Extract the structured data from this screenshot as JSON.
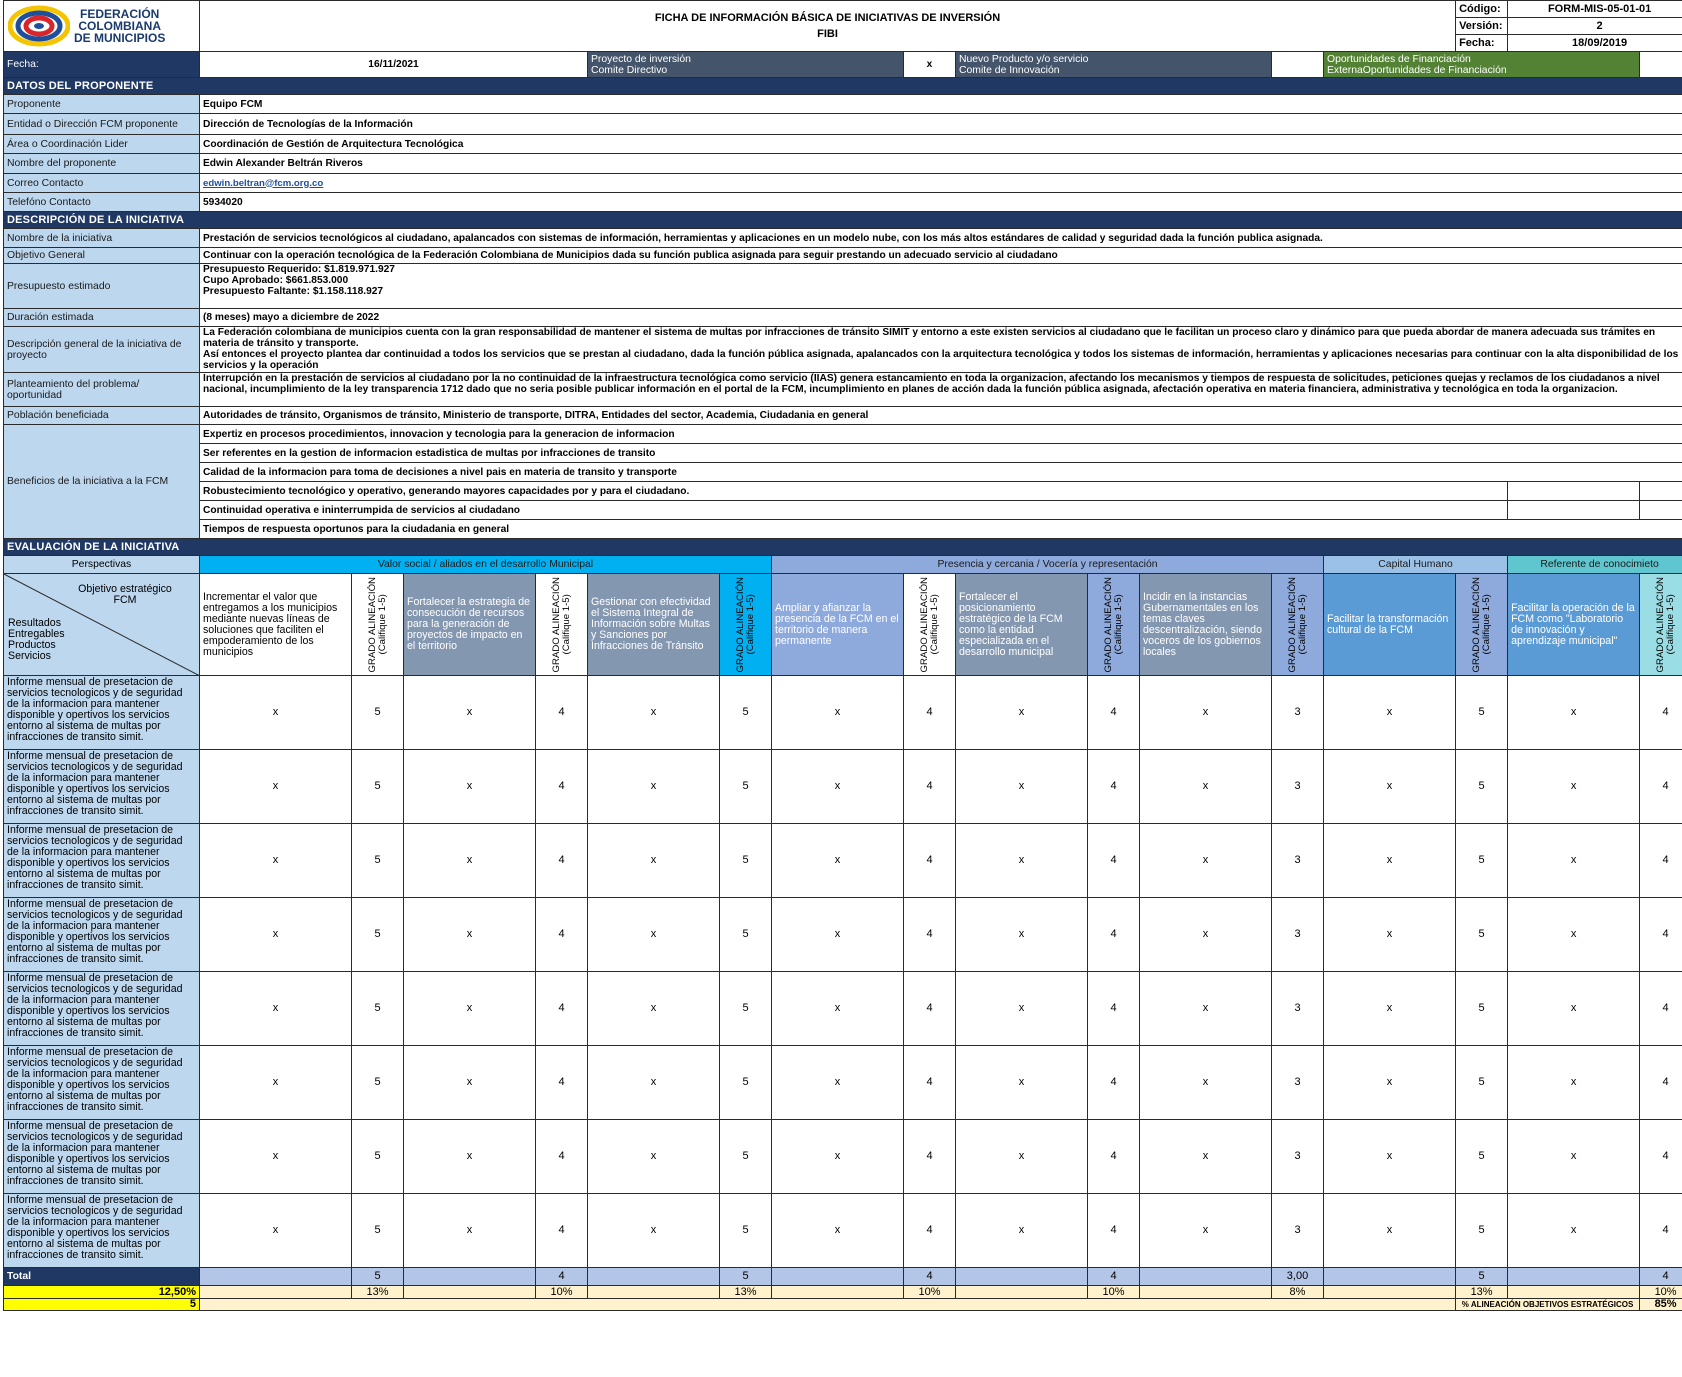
{
  "header": {
    "org_line1": "FEDERACIÓN",
    "org_line2": "COLOMBIANA",
    "org_line3": "DE MUNICIPIOS",
    "title_line1": "FICHA DE INFORMACIÓN BÁSICA DE INICIATIVAS DE INVERSIÓN",
    "title_line2": "FIBI",
    "codigo_label": "Código:",
    "codigo_value": "FORM-MIS-05-01-01",
    "version_label": "Versión:",
    "version_value": "2",
    "fecha_label": "Fecha:",
    "fecha_value": "18/09/2019"
  },
  "fecha_row": {
    "label": "Fecha:",
    "value": "16/11/2021",
    "proyecto_line1": "Proyecto de inversión",
    "proyecto_line2": "Comite Directivo",
    "proyecto_mark": "x",
    "nuevo_line1": "Nuevo Producto y/o servicio",
    "nuevo_line2": "Comite de Innovación",
    "oport_line1": "Oportunidades de Financiación",
    "oport_line2": "ExternaOportunidades de Financiación"
  },
  "proponente": {
    "section": "DATOS DEL PROPONENTE",
    "rows": [
      {
        "label": "Proponente",
        "value": "Equipo FCM"
      },
      {
        "label": "Entidad o Dirección FCM proponente",
        "value": "Dirección de Tecnologías de la Información"
      },
      {
        "label": "Área o Coordinación Lider",
        "value": "Coordinación de Gestión de Arquitectura Tecnológica"
      },
      {
        "label": "Nombre del proponente",
        "value": "Edwin Alexander Beltrán Riveros"
      },
      {
        "label": "Correo Contacto",
        "value": "edwin.beltran@fcm.org.co"
      },
      {
        "label": "Telefóno Contacto",
        "value": "5934020"
      }
    ]
  },
  "descripcion": {
    "section": "DESCRIPCIÓN DE LA INICIATIVA",
    "nombre_label": "Nombre de la iniciativa",
    "nombre_value": "Prestación de servicios tecnológicos al ciudadano, apalancados con sistemas de información, herramientas y aplicaciones en un modelo  nube, con los más altos estándares de calidad y seguridad dada la función publica asignada.",
    "objetivo_label": "Objetivo General",
    "objetivo_value": "Continuar con la operación tecnológica de la Federación Colombiana de Municipios dada su función publica asignada para seguir prestando un adecuado servicio al ciudadano",
    "presupuesto_label": "Presupuesto estimado",
    "presupuesto_l1": "Presupuesto Requerido: $1.819.971.927",
    "presupuesto_l2": "Cupo Aprobado: $661.853.000",
    "presupuesto_l3": "Presupuesto Faltante: $1.158.118.927",
    "duracion_label": "Duración estimada",
    "duracion_value": "(8 meses) mayo a diciembre de 2022",
    "descgen_label": "Descripción general de la iniciativa de proyecto",
    "descgen_p1": "La Federación colombiana de municipios cuenta con la gran responsabilidad de mantener el sistema de multas por infracciones de tránsito SIMIT y entorno a este existen servicios al ciudadano que le facilitan un proceso claro y dinámico para que pueda abordar de manera adecuada sus trámites en materia de tránsito y transporte.",
    "descgen_p2": "Así entonces el proyecto plantea dar continuidad a todos los servicios que se prestan al ciudadano, dada la función pública asignada, apalancados con la arquitectura tecnológica y todos los sistemas de información, herramientas y aplicaciones necesarias para continuar con la alta disponibilidad de los servicios y la operación",
    "problema_label": "Planteamiento del problema/ oportunidad",
    "problema_value": "Interrupción en la prestación de servicios al ciudadano por la no continuidad de la infraestructura tecnológica como servicio (IIAS) genera estancamiento en toda la organizacion, afectando los mecanismos y tiempos de respuesta de solicitudes, peticiones quejas y reclamos de los ciudadanos a nivel nacional, incumplimiento de la ley transparencia 1712 dado que no seria posible publicar información en el portal de la FCM, incumplimiento en planes de acción dada la función pública asignada, afectación operativa en materia financiera, administrativa y tecnológica en toda la organizacion.",
    "poblacion_label": "Población beneficiada",
    "poblacion_value": "Autoridades de tránsito, Organismos de tránsito, Ministerio de transporte, DITRA, Entidades del sector, Academia, Ciudadania en general",
    "beneficios_label": "Beneficios de la iniciativa a la FCM",
    "beneficios": [
      "Expertiz en procesos procedimientos, innovacion y tecnologia para la generacion de informacion",
      "Ser referentes en la gestion de informacion estadistica de multas por infracciones  de transito",
      "Calidad de la informacion para toma de decisiones a nivel pais en materia de transito y transporte",
      "Robustecimiento tecnológico y operativo, generando mayores capacidades por y para el ciudadano.",
      "Continuidad operativa e ininterrumpida de servicios al ciudadano",
      "Tiempos de respuesta oportunos para la ciudadania en general"
    ]
  },
  "evaluacion": {
    "section": "EVALUACIÓN DE LA INICIATIVA",
    "perspectivas_label": "Perspectivas",
    "groups": [
      "Valor social / aliados en el desarrollo Municipal",
      "Presencia y cercania / Vocería y representación",
      "Capital Humano",
      "Referente de conocimieto"
    ],
    "diag_top": "Objetivo estratégico FCM",
    "diag_bottom": [
      "Resultados",
      "Entregables",
      "Productos",
      "Servicios"
    ],
    "grado_l1": "GRADO ALINEACIÓN",
    "grado_l2": "(Califique 1-5)",
    "objectives": [
      "Incrementar el valor que entregamos a los municipios mediante nuevas líneas de soluciones que faciliten el empoderamiento de los municipios",
      "Fortalecer la estrategia de consecución de recursos para la generación de proyectos de impacto en el territorio",
      "Gestionar con efectividad el Sistema Integral de Información sobre Multas y Sanciones por Infracciones de Tránsito",
      "Ampliar y afianzar la presencia de la FCM en el territorio de manera permanente",
      "Fortalecer el posicionamiento estratégico de la FCM como la entidad especializada en el desarrollo municipal",
      "Incidir en la instancias Gubernamentales en los temas claves descentralización, siendo voceros de los gobiernos locales",
      "Facilitar la transformación cultural de la FCM",
      "Facilitar la operación de la FCM como \"Laboratorio de innovación y aprendizaje municipal\""
    ],
    "row_label": "Informe mensual de presetacion de servicios tecnologicos y de seguridad de la informacion para mantener disponible y opertivos los servicios entorno al  sistema de multas por infracciones de transito simit.",
    "mark": "x",
    "rows": [
      [
        5,
        4,
        5,
        4,
        4,
        3,
        5,
        4
      ],
      [
        5,
        4,
        5,
        4,
        4,
        3,
        5,
        4
      ],
      [
        5,
        4,
        5,
        4,
        4,
        3,
        5,
        4
      ],
      [
        5,
        4,
        5,
        4,
        4,
        3,
        5,
        4
      ],
      [
        5,
        4,
        5,
        4,
        4,
        3,
        5,
        4
      ],
      [
        5,
        4,
        5,
        4,
        4,
        3,
        5,
        4
      ],
      [
        5,
        4,
        5,
        4,
        4,
        3,
        5,
        4
      ],
      [
        5,
        4,
        5,
        4,
        4,
        3,
        5,
        4
      ]
    ],
    "total_label": "Total",
    "totals": [
      "5",
      "4",
      "5",
      "4",
      "4",
      "3,00",
      "5",
      "4"
    ],
    "pct_total": "12,50%",
    "pct_value": "5",
    "pcts": [
      "13%",
      "10%",
      "13%",
      "10%",
      "10%",
      "8%",
      "13%",
      "10%"
    ],
    "pct_caption": "% ALINEACIÓN OBJETIVOS ESTRATÉGICOS",
    "pct_final": "85%"
  }
}
